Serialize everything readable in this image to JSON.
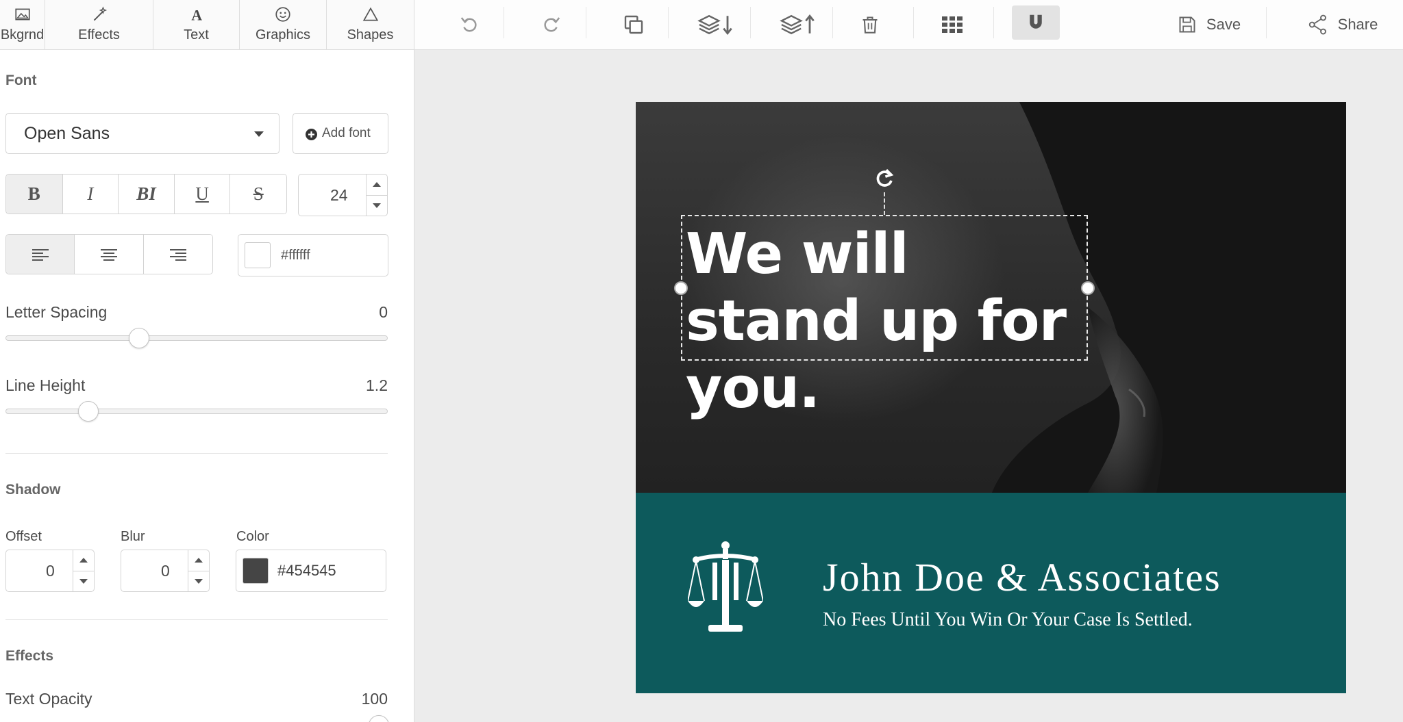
{
  "panel": {
    "tabs": [
      {
        "label": "Bkgrnd",
        "icon": "image-icon"
      },
      {
        "label": "Effects",
        "icon": "magic-wand-icon"
      },
      {
        "label": "Text",
        "icon": "text-icon"
      },
      {
        "label": "Graphics",
        "icon": "smiley-icon"
      },
      {
        "label": "Shapes",
        "icon": "triangle-icon"
      }
    ],
    "font_section": "Font",
    "font_value": "Open Sans",
    "add_font_label": "Add font",
    "style_buttons": [
      "B",
      "I",
      "BI",
      "U",
      "S"
    ],
    "font_size": "24",
    "text_color": "#ffffff",
    "letter_spacing_label": "Letter Spacing",
    "letter_spacing_value": "0",
    "letter_spacing_level": 0.34,
    "line_height_label": "Line Height",
    "line_height_value": "1.2",
    "line_height_level": 0.2,
    "shadow_section": "Shadow",
    "offset_label": "Offset",
    "offset_value": "0",
    "blur_label": "Blur",
    "blur_value": "0",
    "color_label": "Color",
    "shadow_color": "#454545",
    "effects_section": "Effects",
    "opacity_label": "Text Opacity",
    "opacity_value": "100"
  },
  "toolbar": {
    "icons": [
      "undo-icon",
      "redo-icon",
      "duplicate-icon",
      "layer-down-icon",
      "layer-up-icon",
      "trash-icon",
      "grid-icon",
      "magnet-icon"
    ],
    "save_label": "Save",
    "share_label": "Share"
  },
  "design": {
    "headline": "We will stand up for you.",
    "firm_name": "John Doe & Associates",
    "tagline": "No Fees Until You Win Or Your Case Is Settled.",
    "teal_color": "#0d5a5c"
  }
}
